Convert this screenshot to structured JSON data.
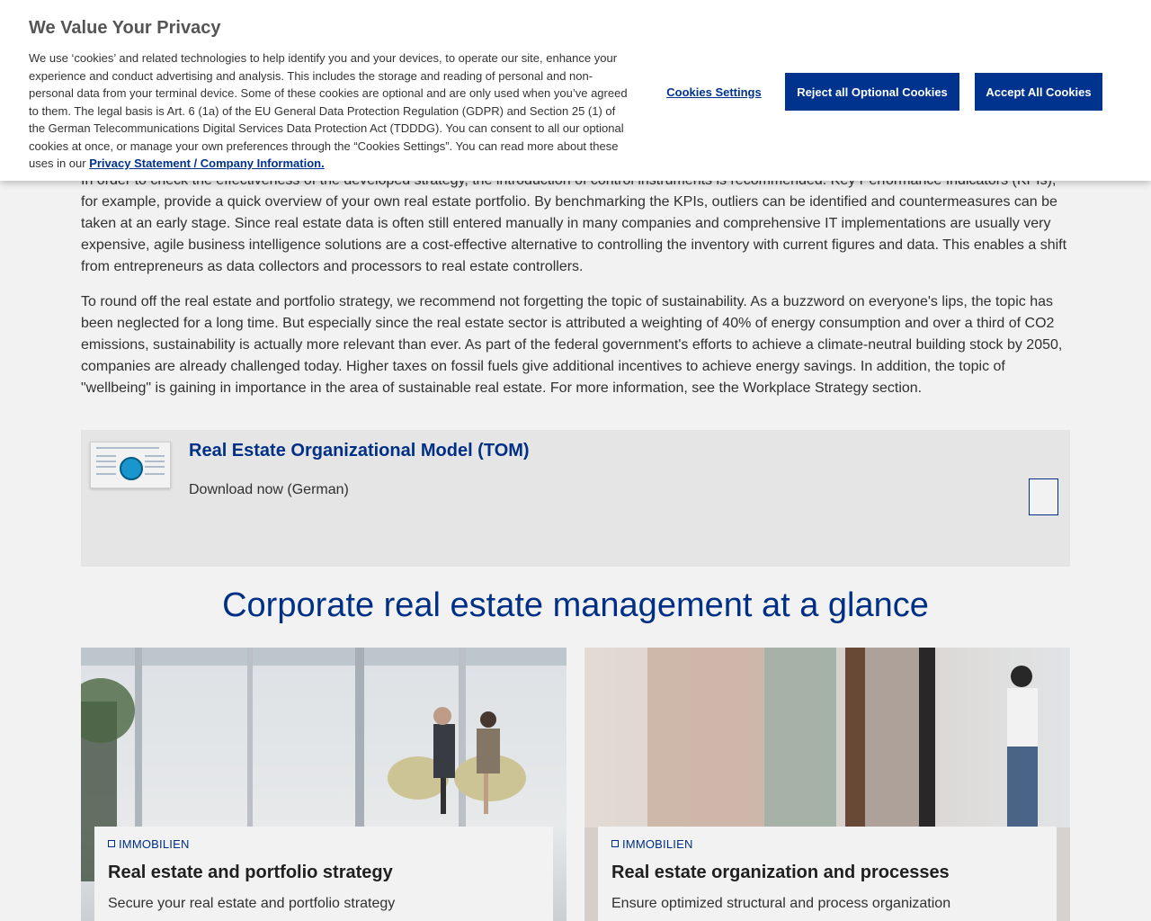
{
  "article": {
    "para1": "In order to check the effectiveness of the developed strategy, the introduction of control instruments is recommended. Key Performance Indicators (KPIs), for example, provide a quick overview of your own real estate portfolio. By benchmarking the KPIs, outliers can be identified and countermeasures can be taken at an early stage. Since real estate data is often still entered manually in many companies and comprehensive IT implementations are usually very expensive, agile business intelligence solutions are a cost-effective alternative to controlling the inventory with current figures and data. This enables a shift from entrepreneurs as data collectors and processors to real estate controllers.",
    "para2": "To round off the real estate and portfolio strategy, we recommend not forgetting the topic of sustainability. As a buzzword on everyone's lips, the topic has been neglected for a long time. But especially since the real estate sector is attributed a weighting of 40% of energy consumption and over a third of CO2 emissions, sustainability is actually more relevant than ever. As part of the federal government's efforts to achieve a climate-neutral building stock by 2050, companies are already challenged today. Higher taxes on fossil fuels give additional incentives to achieve energy savings. In addition, the topic of \"wellbeing\" is gaining in importance in the area of sustainable real estate. For more information, see the Workplace Strategy section."
  },
  "download": {
    "title": "Real Estate Organizational Model (TOM)",
    "link": "Download now (German)",
    "icon": "document-download-icon"
  },
  "section": {
    "heading": "Corporate real estate management at a glance"
  },
  "tiles": [
    {
      "tag": "IMMOBILIEN",
      "title": "Real estate and portfolio strategy",
      "desc": "Secure your real estate and portfolio strategy"
    },
    {
      "tag": "IMMOBILIEN",
      "title": "Real estate organization and processes",
      "desc": "Ensure optimized structural and process organization"
    }
  ],
  "cookie": {
    "title": "We Value Your Privacy",
    "text": "We use ‘cookies’ and related technologies to help identify you and your devices, to operate our site, enhance your experience and conduct advertising and analysis. This includes the storage and reading of personal and non-personal data from your terminal device. Some of these cookies are optional and are only used when you’ve agreed to them. The legal basis is Art. 6 (1a) of the EU General Data Protection Regulation (GDPR) and Section 25 (1) of the German Telecommunications Digital Services Data Protection Act (TDDDG). You can consent to all our optional cookies at once, or manage your own preferences through the “Cookies Settings”. You can read more about these uses in our ",
    "link": "Privacy Statement / Company Information.",
    "settings_label": "Cookies Settings",
    "reject_label": "Reject all Optional Cookies",
    "accept_label": "Accept All Cookies"
  },
  "colors": {
    "brand": "#00338d",
    "text": "#333333",
    "card_bg": "#f2f2f2"
  }
}
